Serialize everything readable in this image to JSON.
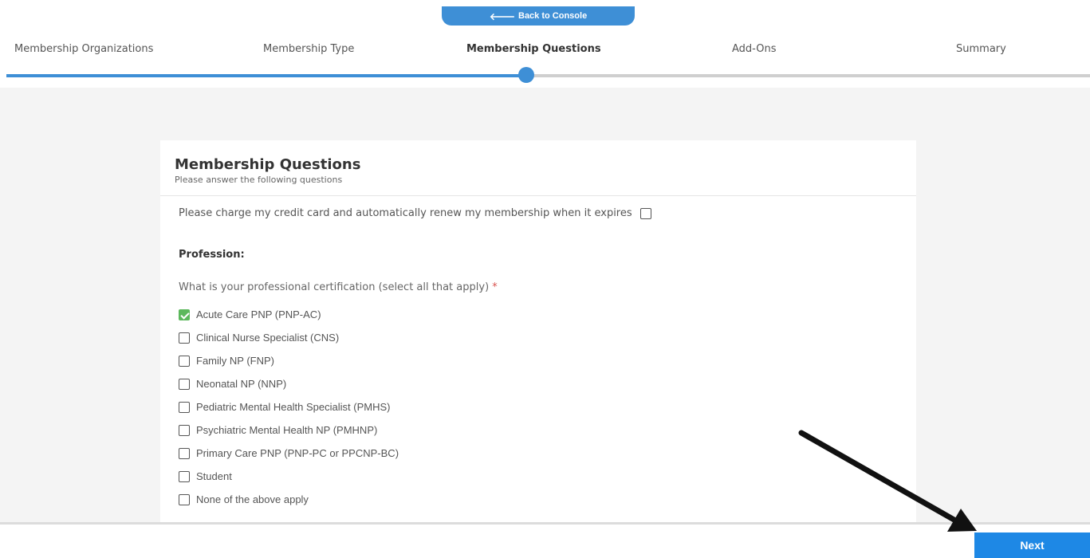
{
  "header": {
    "back_label": "Back to Console",
    "steps": [
      {
        "label": "Membership Organizations",
        "active": false
      },
      {
        "label": "Membership Type",
        "active": false
      },
      {
        "label": "Membership Questions",
        "active": true
      },
      {
        "label": "Add-Ons",
        "active": false
      },
      {
        "label": "Summary",
        "active": false
      }
    ]
  },
  "card": {
    "title": "Membership Questions",
    "subtitle": "Please answer the following questions",
    "autorenew_label": "Please charge my credit card and automatically renew my membership when it expires",
    "autorenew_checked": false,
    "section_label": "Profession:",
    "question_label": "What is your professional certification (select all that apply)",
    "required_marker": "*",
    "options": [
      {
        "label": "Acute Care PNP (PNP-AC)",
        "checked": true
      },
      {
        "label": "Clinical Nurse Specialist (CNS)",
        "checked": false
      },
      {
        "label": "Family NP (FNP)",
        "checked": false
      },
      {
        "label": "Neonatal NP (NNP)",
        "checked": false
      },
      {
        "label": "Pediatric Mental Health Specialist (PMHS)",
        "checked": false
      },
      {
        "label": "Psychiatric Mental Health NP (PMHNP)",
        "checked": false
      },
      {
        "label": "Primary Care PNP (PNP-PC or PPCNP-BC)",
        "checked": false
      },
      {
        "label": "Student",
        "checked": false
      },
      {
        "label": "None of the above apply",
        "checked": false
      }
    ]
  },
  "footer": {
    "next_label": "Next"
  },
  "colors": {
    "accent": "#3e8fd6",
    "next_button": "#1e88e5",
    "check_green": "#5cb85c",
    "required_red": "#d9534f"
  },
  "progress": {
    "completed_fraction": 0.48
  }
}
